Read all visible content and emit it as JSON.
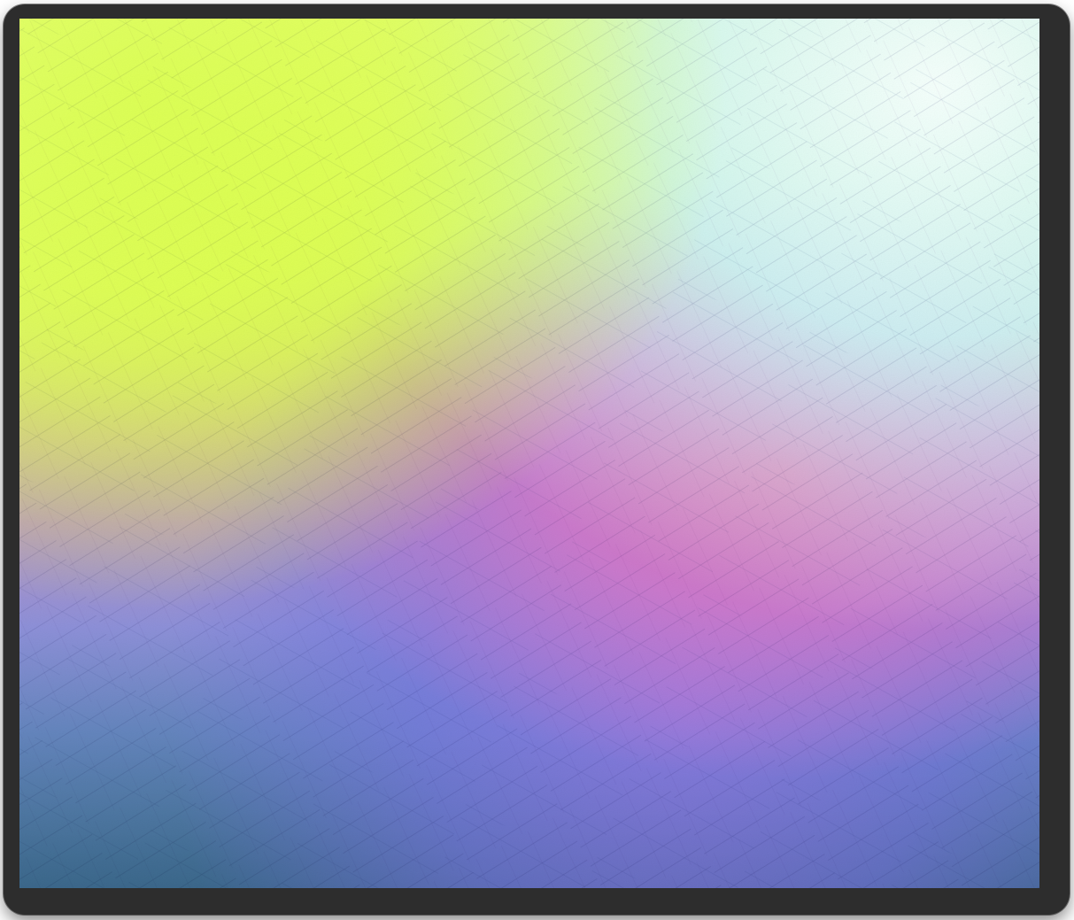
{
  "window": {
    "frame_color": "#2d2d2d"
  },
  "wallpaper": {
    "type": "gradient",
    "colors": [
      "#d9ff45",
      "#ccefef",
      "#e06bb0",
      "#8f84d8",
      "#3f6f95"
    ],
    "texture": "brushed streaks"
  }
}
